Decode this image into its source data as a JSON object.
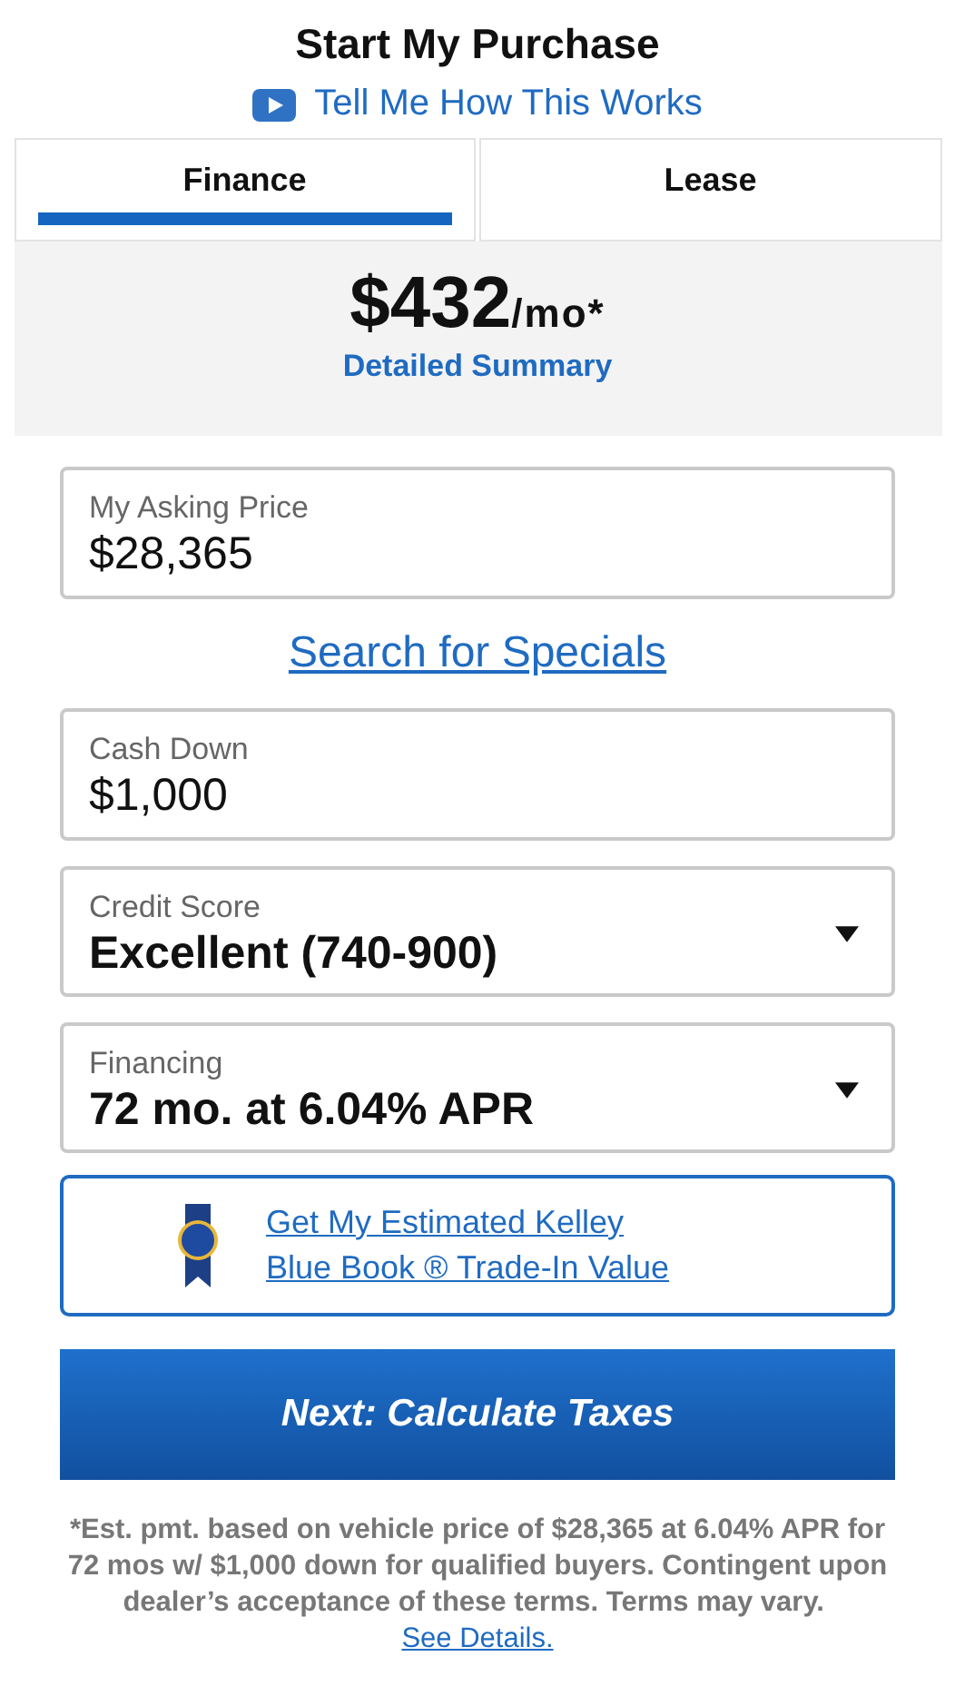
{
  "title": "Start My Purchase",
  "video_link": "Tell Me How This Works",
  "tabs": [
    {
      "label": "Finance",
      "selected": true
    },
    {
      "label": "Lease",
      "selected": false
    }
  ],
  "summary": {
    "amount": "$432",
    "unit": "/mo*",
    "link": "Detailed Summary"
  },
  "fields": [
    {
      "kind": "text",
      "label": "My Asking Price",
      "value": "$28,365"
    },
    {
      "kind": "link",
      "text": "Search for Specials"
    },
    {
      "kind": "text",
      "label": "Cash Down",
      "value": "$1,000"
    },
    {
      "kind": "select",
      "label": "Credit Score",
      "value": "Excellent (740-900)"
    },
    {
      "kind": "select",
      "label": "Financing",
      "value": "72 mo. at 6.04% APR"
    }
  ],
  "trade_in_link": {
    "lines": [
      "Get My Estimated Kelley",
      "Blue Book ® Trade-In Value"
    ]
  },
  "next_button": "Next: Calculate Taxes",
  "disclaimer": {
    "text": "*Est. pmt. based on vehicle price of $28,365 at 6.04% APR for 72 mos w/ $1,000 down for qualified buyers. Contingent upon dealer’s acceptance of these terms. Terms may vary.",
    "link": "See Details."
  }
}
